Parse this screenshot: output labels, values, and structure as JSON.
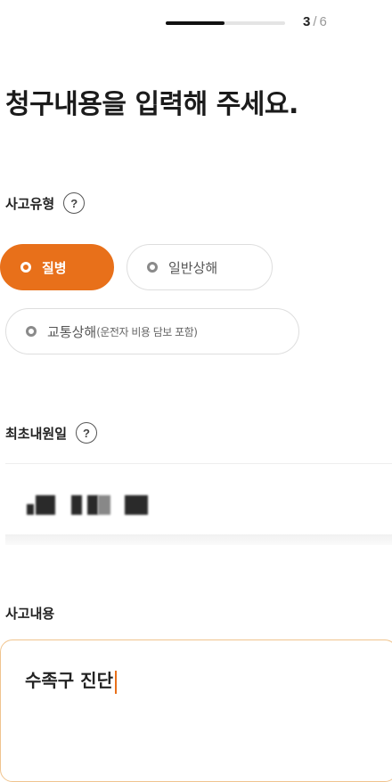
{
  "progress": {
    "current": "3",
    "separator": "/",
    "total": "6",
    "fraction": 0.5
  },
  "title": "청구내용을 입력해 주세요.",
  "accident_type": {
    "label": "사고유형",
    "options": [
      {
        "label": "질병",
        "selected": true
      },
      {
        "label": "일반상해",
        "selected": false
      },
      {
        "label": "교통상해",
        "sub": "(운전자 비용 담보 포함)",
        "selected": false
      }
    ]
  },
  "first_visit_date": {
    "label": "최초내원일",
    "value_redacted": true
  },
  "accident_detail": {
    "label": "사고내용",
    "value": "수족구 진단"
  },
  "colors": {
    "accent": "#e8701a",
    "accent_border": "#f0c48e"
  },
  "icons": {
    "help": "question-circle-icon",
    "radio": "radio-dot-icon"
  },
  "help_glyph": "?"
}
